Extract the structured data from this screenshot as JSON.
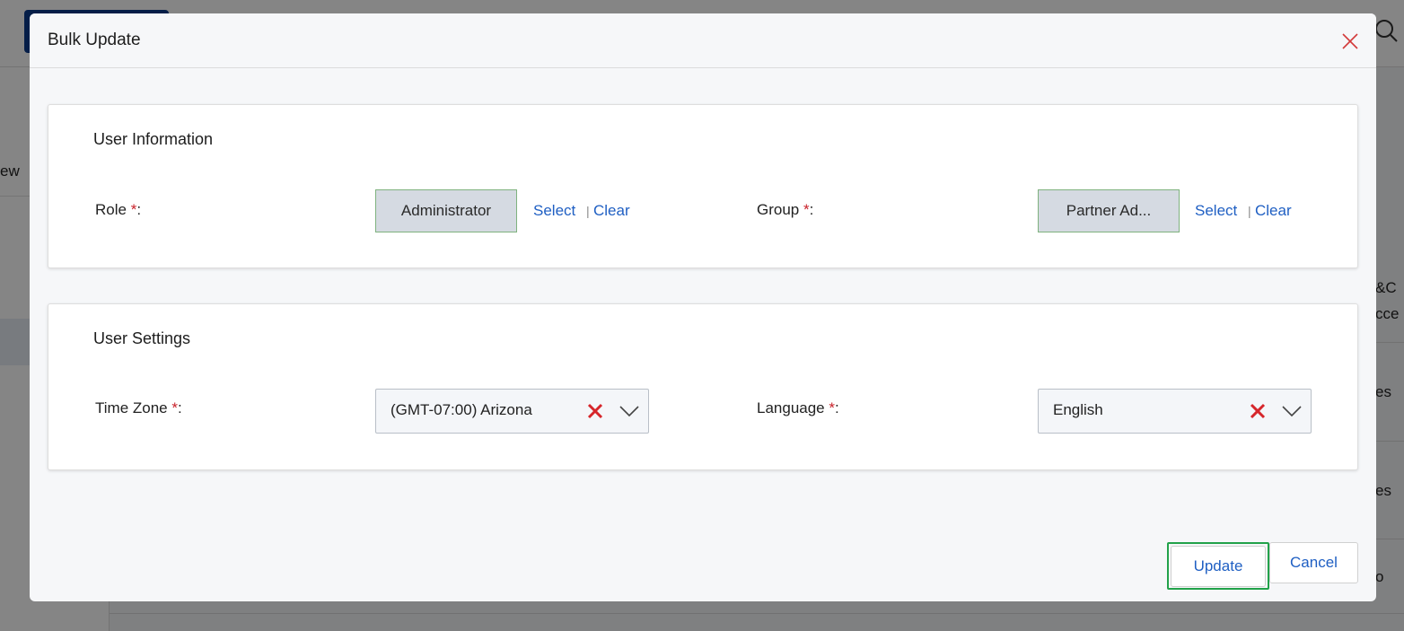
{
  "background": {
    "left_fragment": "ew",
    "right_fragments": [
      "&C",
      "cce",
      "es",
      "es",
      "o"
    ]
  },
  "modal": {
    "title": "Bulk Update",
    "close_icon": "close-icon"
  },
  "user_information": {
    "title": "User Information",
    "role": {
      "label": "Role",
      "required_mark": "*",
      "colon": ":",
      "value": "Administrator",
      "select_label": "Select",
      "separator": "|",
      "clear_label": "Clear"
    },
    "group": {
      "label": "Group",
      "required_mark": "*",
      "colon": ":",
      "value": "Partner Ad...",
      "select_label": "Select",
      "separator": "|",
      "clear_label": "Clear"
    }
  },
  "user_settings": {
    "title": "User Settings",
    "time_zone": {
      "label": "Time Zone",
      "required_mark": "*",
      "colon": ":",
      "value": "(GMT-07:00) Arizona"
    },
    "language": {
      "label": "Language",
      "required_mark": "*",
      "colon": ":",
      "value": "English"
    }
  },
  "footer": {
    "update_label": "Update",
    "cancel_label": "Cancel"
  },
  "colors": {
    "link": "#1f5fc3",
    "required": "#c9212a",
    "clear_x": "#d6262b",
    "focus_ring": "#22a24a"
  }
}
